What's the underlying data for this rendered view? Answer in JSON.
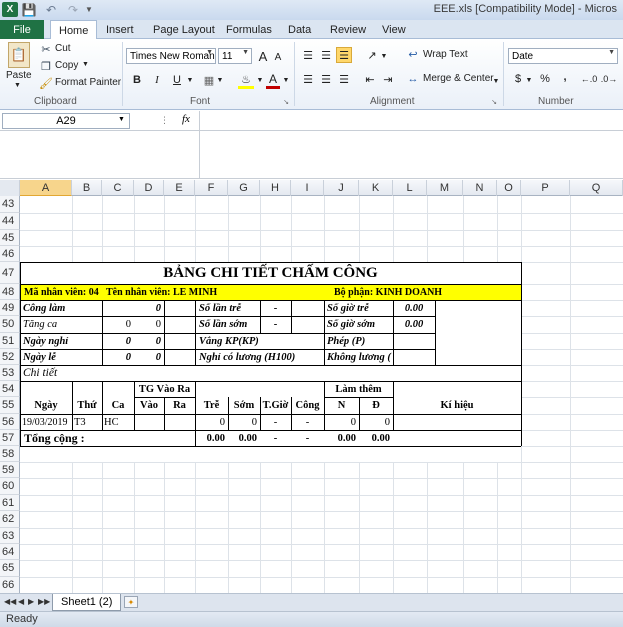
{
  "window": {
    "title": "EEE.xls  [Compatibility Mode]  -  Micros",
    "app_icon": "excel-icon"
  },
  "quick_access": {
    "save_icon": "save-icon",
    "undo_icon": "undo-icon",
    "redo_icon": "redo-icon"
  },
  "tabs": [
    "File",
    "Home",
    "Insert",
    "Page Layout",
    "Formulas",
    "Data",
    "Review",
    "View"
  ],
  "clipboard": {
    "paste": "Paste",
    "cut": "Cut",
    "copy": "Copy",
    "format_painter": "Format Painter",
    "label": "Clipboard"
  },
  "font": {
    "name": "Times New Roman",
    "size": "11",
    "bold": "B",
    "italic": "I",
    "underline": "U",
    "grow": "A",
    "shrink": "A",
    "font_color": "A",
    "label": "Font",
    "fill_color": "#ffff00",
    "text_color": "#c00000"
  },
  "alignment": {
    "wrap_text": "Wrap Text",
    "merge_center": "Merge & Center",
    "label": "Alignment"
  },
  "number": {
    "format": "Date",
    "currency": "$",
    "percent": "%",
    "comma": ",",
    "label": "Number"
  },
  "formula_bar": {
    "name_box": "A29",
    "fx": "fx",
    "formula": ""
  },
  "columns": [
    "A",
    "B",
    "C",
    "D",
    "E",
    "F",
    "G",
    "H",
    "I",
    "J",
    "K",
    "L",
    "M",
    "N",
    "O",
    "P",
    "Q"
  ],
  "rows": [
    "43",
    "44",
    "45",
    "46",
    "47",
    "48",
    "49",
    "50",
    "51",
    "52",
    "53",
    "54",
    "55",
    "56",
    "57",
    "58",
    "59",
    "60",
    "61",
    "62",
    "63",
    "64",
    "65",
    "66"
  ],
  "report": {
    "title": "BẢNG CHI TIẾT CHẤM CÔNG",
    "emp_id_label": "Mã nhân viên: 04",
    "emp_name_label": "Tên nhân viên: LE MINH",
    "dept_label": "Bộ phận: KINH DOANH",
    "cong_lam": "Công làm",
    "cong_lam_v": "0",
    "tang_ca": "Tăng ca",
    "tang_ca_v1": "0",
    "tang_ca_v2": "0",
    "ngay_nghi": "Ngày nghỉ",
    "ngay_nghi_v1": "0",
    "ngay_nghi_v2": "0",
    "ngay_le": "Ngày lễ",
    "ngay_le_v1": "0",
    "ngay_le_v2": "0",
    "so_lan_tre": "Số lần trễ",
    "so_lan_tre_v": "-",
    "so_lan_som": "Số lần sớm",
    "so_lan_som_v": "-",
    "vang_kp": "Vắng KP(KP)",
    "nghi_co_luong": "Nghỉ có lương (H100)",
    "so_gio_tre": "Số giờ trễ",
    "so_gio_tre_v": "0.00",
    "so_gio_som": "Số giờ sớm",
    "so_gio_som_v": "0.00",
    "phep": "Phép (P)",
    "khong_luong": "Không lương (",
    "chi_tiet": "Chi tiết",
    "tg_vao_ra": "TG Vào Ra",
    "lam_them": "Làm thêm",
    "h_ngay": "Ngày",
    "h_thu": "Thứ",
    "h_ca": "Ca",
    "h_vao": "Vào",
    "h_ra": "Ra",
    "h_tre": "Trễ",
    "h_som": "Sớm",
    "h_tgio": "T.Giờ",
    "h_cong": "Công",
    "h_n": "N",
    "h_d": "Đ",
    "h_ki_hieu": "Kí hiệu",
    "d_ngay": "19/03/2019",
    "d_thu": "T3",
    "d_ca": "HC",
    "d_tre": "0",
    "d_som": "0",
    "d_tgio": "-",
    "d_cong": "-",
    "d_n": "0",
    "d_d": "0",
    "tong": "Tổng cộng :",
    "t_tre": "0.00",
    "t_som": "0.00",
    "t_tgio": "-",
    "t_cong": "-",
    "t_n": "0.00",
    "t_d": "0.00",
    "title_fill": "#ffff00"
  },
  "sheet_tab": "Sheet1 (2)",
  "status": "Ready"
}
